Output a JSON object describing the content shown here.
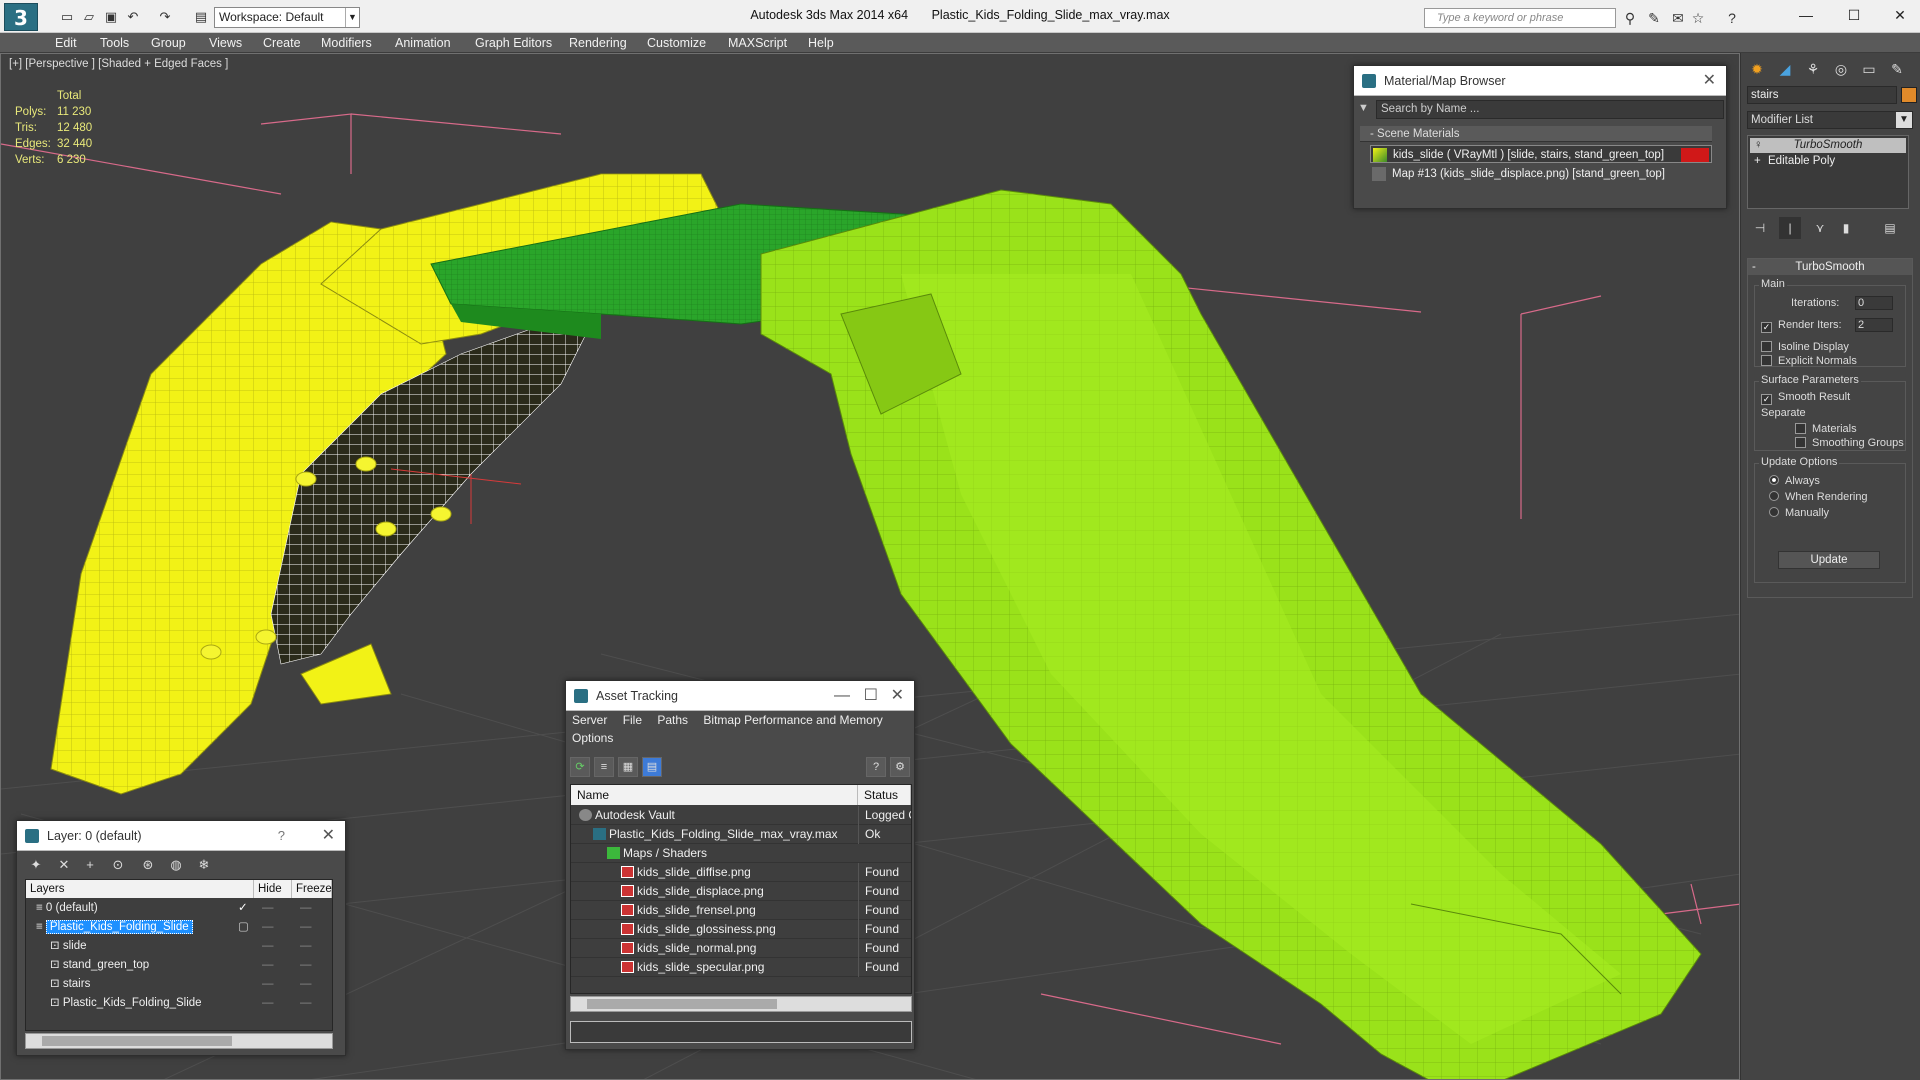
{
  "app": {
    "title": "Autodesk 3ds Max  2014 x64",
    "file": "Plastic_Kids_Folding_Slide_max_vray.max",
    "workspace": "Workspace: Default",
    "search_placeholder": "Type a keyword or phrase"
  },
  "menu": [
    "Edit",
    "Tools",
    "Group",
    "Views",
    "Create",
    "Modifiers",
    "Animation",
    "Graph Editors",
    "Rendering",
    "Customize",
    "MAXScript",
    "Help"
  ],
  "viewport": {
    "label": "[+] [Perspective ] [Shaded + Edged Faces ]",
    "stats": {
      "header": "Total",
      "rows": [
        {
          "label": "Polys:",
          "value": "11 230"
        },
        {
          "label": "Tris:",
          "value": "12 480"
        },
        {
          "label": "Edges:",
          "value": "32 440"
        },
        {
          "label": "Verts:",
          "value": "6 230"
        }
      ]
    }
  },
  "material_browser": {
    "title": "Material/Map Browser",
    "search_placeholder": "Search by Name ...",
    "section": "- Scene Materials",
    "items": [
      {
        "label": "kids_slide  ( VRayMtl ) [slide, stairs, stand_green_top]",
        "swatch": "#3b8a2a"
      },
      {
        "label": "Map #13 (kids_slide_displace.png) [stand_green_top]",
        "swatch": "#6a6a6a"
      }
    ]
  },
  "asset_tracking": {
    "title": "Asset Tracking",
    "menu_row1": [
      "Server",
      "File",
      "Paths",
      "Bitmap Performance and Memory"
    ],
    "menu_row2": "Options",
    "col_name": "Name",
    "col_status": "Status",
    "rows": [
      {
        "name": "Autodesk Vault",
        "status": "Logged O",
        "indent": 0,
        "icon": "vault"
      },
      {
        "name": "Plastic_Kids_Folding_Slide_max_vray.max",
        "status": "Ok",
        "indent": 1,
        "icon": "max"
      },
      {
        "name": "Maps / Shaders",
        "status": "",
        "indent": 2,
        "icon": "maps"
      },
      {
        "name": "kids_slide_diffise.png",
        "status": "Found",
        "indent": 3,
        "icon": "png"
      },
      {
        "name": "kids_slide_displace.png",
        "status": "Found",
        "indent": 3,
        "icon": "png"
      },
      {
        "name": "kids_slide_frensel.png",
        "status": "Found",
        "indent": 3,
        "icon": "png"
      },
      {
        "name": "kids_slide_glossiness.png",
        "status": "Found",
        "indent": 3,
        "icon": "png"
      },
      {
        "name": "kids_slide_normal.png",
        "status": "Found",
        "indent": 3,
        "icon": "png"
      },
      {
        "name": "kids_slide_specular.png",
        "status": "Found",
        "indent": 3,
        "icon": "png"
      }
    ]
  },
  "layers": {
    "title": "Layer: 0 (default)",
    "col_layers": "Layers",
    "col_hide": "Hide",
    "col_freeze": "Freeze",
    "rows": [
      {
        "name": "0 (default)",
        "indent": 1,
        "selected": false,
        "check": true
      },
      {
        "name": "Plastic_Kids_Folding_Slide",
        "indent": 1,
        "selected": true,
        "check": false
      },
      {
        "name": "slide",
        "indent": 2,
        "selected": false,
        "check": false
      },
      {
        "name": "stand_green_top",
        "indent": 2,
        "selected": false,
        "check": false
      },
      {
        "name": "stairs",
        "indent": 2,
        "selected": false,
        "check": false
      },
      {
        "name": "Plastic_Kids_Folding_Slide",
        "indent": 2,
        "selected": false,
        "check": false
      }
    ]
  },
  "command_panel": {
    "object_name": "stairs",
    "modifier_list": "Modifier List",
    "stack": [
      "TurboSmooth",
      "Editable Poly"
    ],
    "rollout_title": "TurboSmooth",
    "main_group": "Main",
    "iterations_label": "Iterations:",
    "iterations_value": "0",
    "render_iters_label": "Render Iters:",
    "render_iters_value": "2",
    "isoline_display": "Isoline Display",
    "explicit_normals": "Explicit Normals",
    "surface_group": "Surface Parameters",
    "smooth_result": "Smooth Result",
    "separate": "Separate",
    "materials": "Materials",
    "smoothing_groups": "Smoothing Groups",
    "update_group": "Update Options",
    "always": "Always",
    "when_rendering": "When Rendering",
    "manually": "Manually",
    "update_button": "Update"
  },
  "colors": {
    "slide_green": "#9ae21a",
    "stairs_yellow": "#f2f216",
    "platform_green": "#2aa52a",
    "selection_blue": "#1e90ff"
  }
}
